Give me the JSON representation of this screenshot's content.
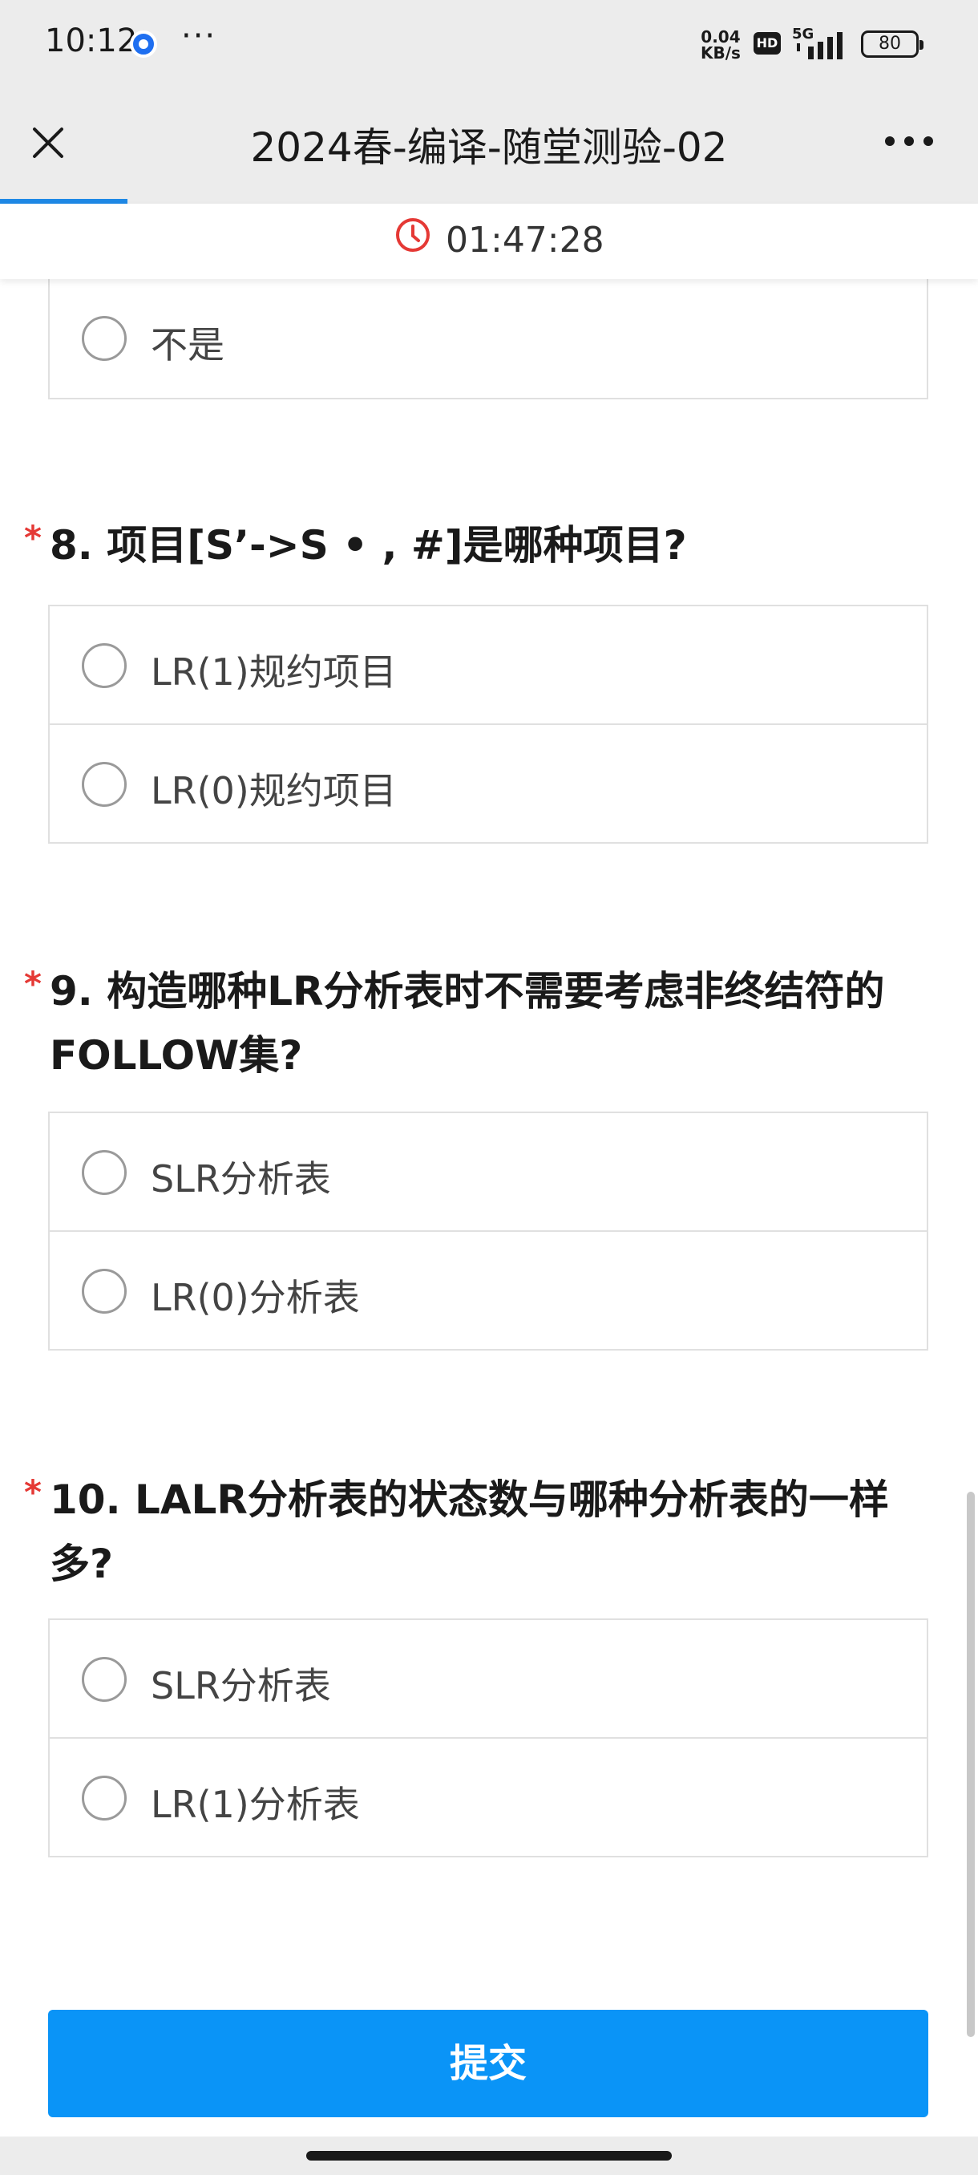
{
  "status_bar": {
    "time": "10:12",
    "more": "···",
    "net_speed_value": "0.04",
    "net_speed_unit": "KB/s",
    "hd_badge": "HD",
    "network_type": "5G",
    "battery_level": "80",
    "icons": [
      "app-icon",
      "signal-icon",
      "battery-icon"
    ]
  },
  "header": {
    "title": "2024春-编译-随堂测验-02",
    "close_icon": "close-icon",
    "more_icon": "more-menu-icon",
    "progress_fraction": 0.13
  },
  "timer": {
    "icon": "clock-icon",
    "value": "01:47:28"
  },
  "previous_option": {
    "label": "不是"
  },
  "questions": [
    {
      "required_mark": "*",
      "text": "8. 项目[S’->S • , #]是哪种项目?",
      "options": [
        {
          "label": "LR(1)规约项目"
        },
        {
          "label": "LR(0)规约项目"
        }
      ]
    },
    {
      "required_mark": "*",
      "text": "9. 构造哪种LR分析表时不需要考虑非终结符的FOLLOW集?",
      "options": [
        {
          "label": "SLR分析表"
        },
        {
          "label": "LR(0)分析表"
        }
      ]
    },
    {
      "required_mark": "*",
      "text": "10. LALR分析表的状态数与哪种分析表的一样多?",
      "options": [
        {
          "label": "SLR分析表"
        },
        {
          "label": "LR(1)分析表"
        }
      ]
    }
  ],
  "submit": {
    "label": "提交"
  },
  "colors": {
    "accent": "#0a94f7",
    "progress": "#1e88e5",
    "required": "#e53935",
    "timer_icon": "#e53935"
  }
}
